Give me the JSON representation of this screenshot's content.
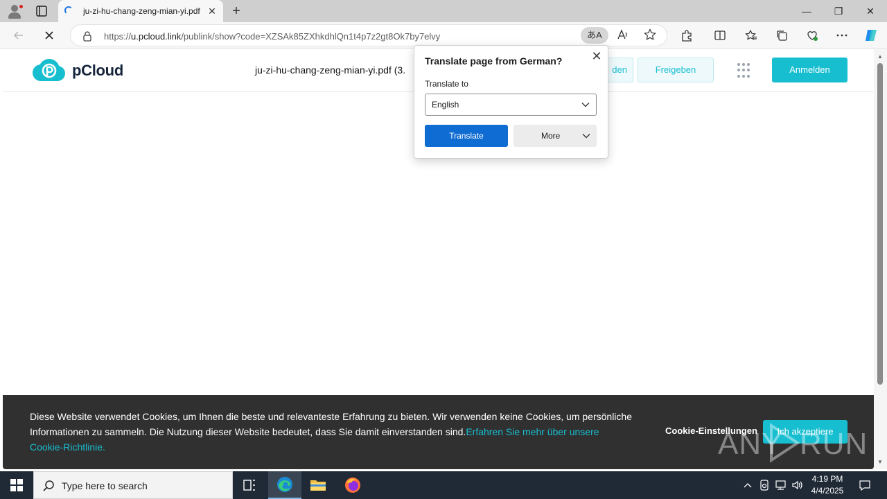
{
  "browser": {
    "tab_title": "ju-zi-hu-chang-zeng-mian-yi.pdf",
    "url_prefix": "https://",
    "url_host": "u.pcloud.link",
    "url_path": "/publink/show?code=XZSAk85ZXhkdhlQn1t4p7z2gt8Ok7by7elvy",
    "translate_glyph": "あA",
    "icons": [
      "profile-icon",
      "tab-actions-icon",
      "loading-icon",
      "close-icon",
      "plus-icon",
      "minimize-icon",
      "restore-icon",
      "close-window-icon",
      "back-icon",
      "stop-icon",
      "lock-icon",
      "translate-icon",
      "read-aloud-icon",
      "favorite-star-icon",
      "extensions-icon",
      "split-screen-icon",
      "favorites-icon",
      "collections-icon",
      "performance-icon",
      "more-icon",
      "copilot-icon"
    ]
  },
  "site": {
    "brand": "pCloud",
    "filename": "ju-zi-hu-chang-zeng-mian-yi.pdf (3.",
    "download_label": "den",
    "share_label": "Freigeben",
    "login_label": "Anmelden",
    "accent_color": "#17bed0"
  },
  "translate_popup": {
    "title": "Translate page from German?",
    "label": "Translate to",
    "selected_language": "English",
    "translate_button": "Translate",
    "more_button": "More",
    "primary_color": "#0f6cd2"
  },
  "cookie_banner": {
    "text": "Diese Website verwendet Cookies, um Ihnen die beste und relevanteste Erfahrung zu bieten. Wir verwenden keine Cookies, um persönliche Informationen zu sammeln. Die Nutzung dieser Website bedeutet, dass Sie damit einverstanden sind.",
    "link_text": "Erfahren Sie mehr über unsere Cookie-Richtlinie.",
    "settings_label": "Cookie-Einstellungen",
    "accept_label": "Ich akzeptiere"
  },
  "watermark": {
    "left": "ANY",
    "right": "RUN"
  },
  "taskbar": {
    "search_placeholder": "Type here to search",
    "time": "4:19 PM",
    "date": "4/4/2025",
    "apps": [
      "task-view-icon",
      "edge-icon",
      "file-explorer-icon",
      "firefox-icon"
    ]
  }
}
